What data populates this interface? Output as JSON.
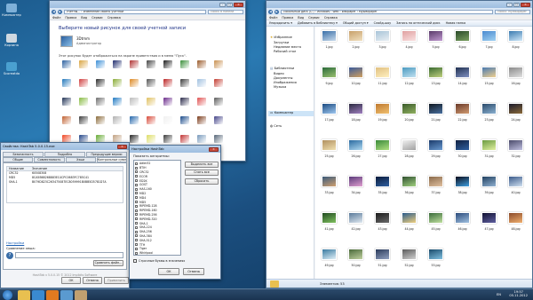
{
  "desktop": {
    "icons": [
      {
        "label": "Компьютер",
        "color": "#7fb0d8"
      },
      {
        "label": "Корзина",
        "color": "#cfd8e0"
      },
      {
        "label": "Scoreatda",
        "color": "#4aa0d0"
      }
    ]
  },
  "account_window": {
    "address": "Учетны... › Изменение своего учетной",
    "search": "Поиск в панели",
    "menu": [
      "Файл",
      "Правка",
      "Вид",
      "Сервис",
      "Справка"
    ],
    "heading": "Выберите новый рисунок для своей учетной записи",
    "username": "3Dtmm",
    "user_role": "Администратор",
    "note": "Этот рисунок будет отображаться на экране приветствия и в меню \"Пуск\".",
    "picture_colors": [
      "#2b5f9e",
      "#d9a441",
      "#3b8ed6",
      "#1e2b6d",
      "#b03030",
      "#444444",
      "#1a1a1a",
      "#3a8f3a",
      "#9a5a2a",
      "#c89050",
      "#2277bb",
      "#d04040",
      "#2a2a2a",
      "#88aa33",
      "#dd8822",
      "#555555",
      "#bb2222",
      "#3a3a3a",
      "#a0c0e0",
      "#c23a2f",
      "#223355",
      "#88bb44",
      "#6e6e6e",
      "#1f78c1",
      "#bbbbbb",
      "#e0c060",
      "#6a2a8a",
      "#2a2a4a",
      "#e05050",
      "#5a5a5a",
      "#c06030",
      "#3c3c3c",
      "#8a6a3a",
      "#b0b0b0",
      "#2266aa",
      "#d84a3a",
      "#f0f0f0",
      "#1a4a8a",
      "#7a3a1a",
      "#444488",
      "#ee4422",
      "#224488",
      "#66aa33",
      "#c0a080",
      "#222222",
      "#dddd66",
      "#3a3a3a",
      "#c03030",
      "#7799bb",
      "#556677"
    ]
  },
  "explorer": {
    "address": "Локальный диск (C:) › Windows › Web › Wallpaper › MyWallpaper",
    "search": "Поиск: MyWallpaper",
    "menu": [
      "Файл",
      "Правка",
      "Вид",
      "Сервис",
      "Справка"
    ],
    "toolbar": [
      "Упорядочить ▾",
      "Добавить в библиотеку ▾",
      "Общий доступ ▾",
      "Слайд-шоу",
      "Запись на оптический диск",
      "Новая папка"
    ],
    "nav": {
      "favorites": "Избранное",
      "favorites_items": [
        "Загрузки",
        "Недавние места",
        "Рабочий стол"
      ],
      "libraries": "Библиотеки",
      "libraries_items": [
        "Видео",
        "Документы",
        "Изображения",
        "Музыка"
      ],
      "computer": "Компьютер",
      "network": "Сеть"
    },
    "files": [
      {
        "name": "1.jpg",
        "c1": "#3a6fa8",
        "c2": "#c7d9ea"
      },
      {
        "name": "2.jpg",
        "c1": "#c8a06a",
        "c2": "#f0e0c0"
      },
      {
        "name": "3.jpg",
        "c1": "#a8c4d8",
        "c2": "#e8eef2"
      },
      {
        "name": "4.jpg",
        "c1": "#e0a0a0",
        "c2": "#f8e0e0"
      },
      {
        "name": "5.jpg",
        "c1": "#5a3a6a",
        "c2": "#c09ad0"
      },
      {
        "name": "6.jpg",
        "c1": "#2a4a2a",
        "c2": "#7aa060"
      },
      {
        "name": "7.jpg",
        "c1": "#4a8ad0",
        "c2": "#a0d0f0"
      },
      {
        "name": "8.jpg",
        "c1": "#3a7ab0",
        "c2": "#d0e8f8"
      },
      {
        "name": "9.jpg",
        "c1": "#2a6a3a",
        "c2": "#9ac070"
      },
      {
        "name": "10.jpg",
        "c1": "#3a5a9a",
        "c2": "#d0a060"
      },
      {
        "name": "11.jpg",
        "c1": "#e0c080",
        "c2": "#fff0c0"
      },
      {
        "name": "12.jpg",
        "c1": "#4a9ac0",
        "c2": "#c0e0f0"
      },
      {
        "name": "13.jpg",
        "c1": "#3a6a30",
        "c2": "#c0d080"
      },
      {
        "name": "14.jpg",
        "c1": "#203050",
        "c2": "#8090c0"
      },
      {
        "name": "15.jpg",
        "c1": "#4a7ab0",
        "c2": "#f0d090"
      },
      {
        "name": "16.jpg",
        "c1": "#8a8a8a",
        "c2": "#e0e0e0"
      },
      {
        "name": "17.jpg",
        "c1": "#1a4a80",
        "c2": "#a0c8f0"
      },
      {
        "name": "18.jpg",
        "c1": "#2a2a40",
        "c2": "#a080c0"
      },
      {
        "name": "19.jpg",
        "c1": "#c07a30",
        "c2": "#f0c070"
      },
      {
        "name": "20.jpg",
        "c1": "#3a5a2a",
        "c2": "#90b060"
      },
      {
        "name": "21.jpg",
        "c1": "#101820",
        "c2": "#4a70a0"
      },
      {
        "name": "22.jpg",
        "c1": "#6a3a2a",
        "c2": "#d09a70"
      },
      {
        "name": "23.jpg",
        "c1": "#2a4a6a",
        "c2": "#8ab0d0"
      },
      {
        "name": "24.jpg",
        "c1": "#1a1a2a",
        "c2": "#8a6a3a"
      },
      {
        "name": "25.jpg",
        "c1": "#b09060",
        "c2": "#f0e0b0"
      },
      {
        "name": "26.jpg",
        "c1": "#2a6aa0",
        "c2": "#b0d8f0"
      },
      {
        "name": "27.jpg",
        "c1": "#3a8a3a",
        "c2": "#b0e080"
      },
      {
        "name": "28.jpg",
        "c1": "#f0f0f0",
        "c2": "#a0a0a0"
      },
      {
        "name": "29.jpg",
        "c1": "#1a3a6a",
        "c2": "#6a9ad0"
      },
      {
        "name": "30.jpg",
        "c1": "#102040",
        "c2": "#3060a0"
      },
      {
        "name": "31.jpg",
        "c1": "#6a9a40",
        "c2": "#e0f0a0"
      },
      {
        "name": "32.jpg",
        "c1": "#4a4a6a",
        "c2": "#c0c0e0"
      },
      {
        "name": "33.jpg",
        "c1": "#3a5a7a",
        "c2": "#d0a070"
      },
      {
        "name": "34.jpg",
        "c1": "#5a3a7a",
        "c2": "#e0a0d0"
      },
      {
        "name": "35.jpg",
        "c1": "#0a1a3a",
        "c2": "#3060a0"
      },
      {
        "name": "36.jpg",
        "c1": "#305030",
        "c2": "#a0d080"
      },
      {
        "name": "37.jpg",
        "c1": "#8a6a4a",
        "c2": "#e0c0a0"
      },
      {
        "name": "38.jpg",
        "c1": "#0a0a1a",
        "c2": "#40a0e0"
      },
      {
        "name": "39.jpg",
        "c1": "#204060",
        "c2": "#90b0d0"
      },
      {
        "name": "40.jpg",
        "c1": "#3a5a8a",
        "c2": "#d0e0f0"
      },
      {
        "name": "41.jpg",
        "c1": "#204a20",
        "c2": "#80c060"
      },
      {
        "name": "42.jpg",
        "c1": "#5a7a9a",
        "c2": "#e0e8f0"
      },
      {
        "name": "43.jpg",
        "c1": "#1a1a1a",
        "c2": "#6a6a6a"
      },
      {
        "name": "44.jpg",
        "c1": "#2a5a8a",
        "c2": "#f0d080"
      },
      {
        "name": "45.jpg",
        "c1": "#3a6a3a",
        "c2": "#c0e0a0"
      },
      {
        "name": "46.jpg",
        "c1": "#2a4a7a",
        "c2": "#a0c0e0"
      },
      {
        "name": "47.jpg",
        "c1": "#101030",
        "c2": "#6060a0"
      },
      {
        "name": "48.jpg",
        "c1": "#8a4a2a",
        "c2": "#f0b070"
      },
      {
        "name": "49.jpg",
        "c1": "#3a7aa0",
        "c2": "#e0f0f8"
      },
      {
        "name": "50.jpg",
        "c1": "#4a6a3a",
        "c2": "#c0d0a0"
      },
      {
        "name": "51.jpg",
        "c1": "#2a3a5a",
        "c2": "#90a0c0"
      },
      {
        "name": "52.jpg",
        "c1": "#5a5a5a",
        "c2": "#d0d0d0"
      },
      {
        "name": "53.jpg",
        "c1": "#1a4a6a",
        "c2": "#80c0e0"
      }
    ],
    "status": "Элементов: 53"
  },
  "props_window": {
    "title": "Свойства: HashTab 5.0.0.15.exe",
    "tabs_row1": [
      "Безопасность",
      "Подробно",
      "Предыдущие версии"
    ],
    "tabs_row2": [
      "Общие",
      "Совместимость",
      "Хэши",
      "Контрольные суммы"
    ],
    "col_name": "Название",
    "col_value": "Значение",
    "hashes": [
      {
        "name": "CRC32",
        "value": "60508308"
      },
      {
        "name": "MD5",
        "value": "8CA5B68268883EC4CPC0683FC785C41"
      },
      {
        "name": "SHA-1",
        "value": "B079D823C263475087EC8059991B0BB5D5781D7A"
      }
    ],
    "settings_link": "Настройки",
    "compare_label": "Сравнение хеша:",
    "compare_button": "Сравнить файл...",
    "footer": "HashTab v 5.0.0.15 © 2012 Implbits Software",
    "ok": "ОК",
    "cancel": "Отмена",
    "apply": "Применить"
  },
  "hashtab_settings": {
    "title": "Настройки HashTab",
    "list_label": "Показать алгоритмы:",
    "algorithms": [
      "Adler32",
      "BTIH",
      "CRC32",
      "ECOR",
      "ED2K",
      "GOST",
      "HAS-160",
      "MD2",
      "MD4",
      "MD5",
      "RIPEMD-128",
      "RIPEMD-160",
      "RIPEMD-256",
      "RIPEMD-320",
      "SHA-1",
      "SHA-224",
      "SHA-256",
      "SHA-384",
      "SHA-512",
      "TTH",
      "Tiger",
      "Whirlpool"
    ],
    "select_all": "Выделить все",
    "clear_all": "Снять все",
    "reset": "Сбросить",
    "lowercase": "Строчные буквы в значениях",
    "ok": "ОК",
    "cancel": "Отмена"
  },
  "taskbar": {
    "apps": [
      {
        "name": "explorer-app",
        "color": "#e8c050"
      },
      {
        "name": "ie-app",
        "color": "#3a8ad0"
      },
      {
        "name": "media-app",
        "color": "#e07a20"
      },
      {
        "name": "control-panel-app",
        "color": "#5a9ad0"
      },
      {
        "name": "wallpaper-app",
        "color": "#c0a070"
      }
    ],
    "lang": "EN",
    "time": "19:57",
    "date": "05.11.2012"
  }
}
